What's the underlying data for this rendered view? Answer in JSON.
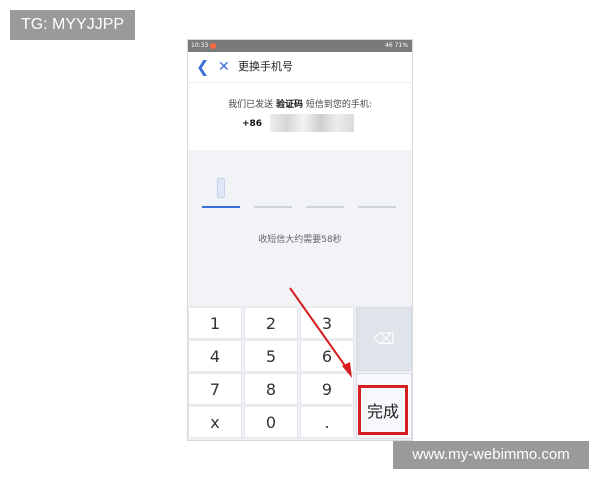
{
  "watermarks": {
    "top_left": "TG: MYYJJPP",
    "bottom_right": "www.my-webimmo.com"
  },
  "statusbar": {
    "time": "10:33",
    "right": "46 71%"
  },
  "header": {
    "back_icon": "chevron-left-icon",
    "close_icon": "close-icon",
    "title": "更换手机号"
  },
  "message": {
    "prefix": "我们已发送 ",
    "highlight": "验证码",
    "suffix": " 短信到您的手机:",
    "country_code": "+86"
  },
  "verification": {
    "slots": [
      {
        "state": "active"
      },
      {
        "state": "empty"
      },
      {
        "state": "empty"
      },
      {
        "state": "empty"
      }
    ],
    "countdown": "收短信大约需要58秒"
  },
  "keypad": {
    "keys": [
      "1",
      "2",
      "3",
      "4",
      "5",
      "6",
      "7",
      "8",
      "9",
      "x",
      "0",
      "."
    ],
    "backspace_icon": "backspace-icon",
    "done_label": "完成"
  },
  "annotation": {
    "arrow_color": "#d62020",
    "highlight_color": "#d62020"
  },
  "colors": {
    "accent": "#3a6fd8",
    "keypad_bg": "#eef0f4",
    "code_area_bg": "#f2f3f7"
  }
}
